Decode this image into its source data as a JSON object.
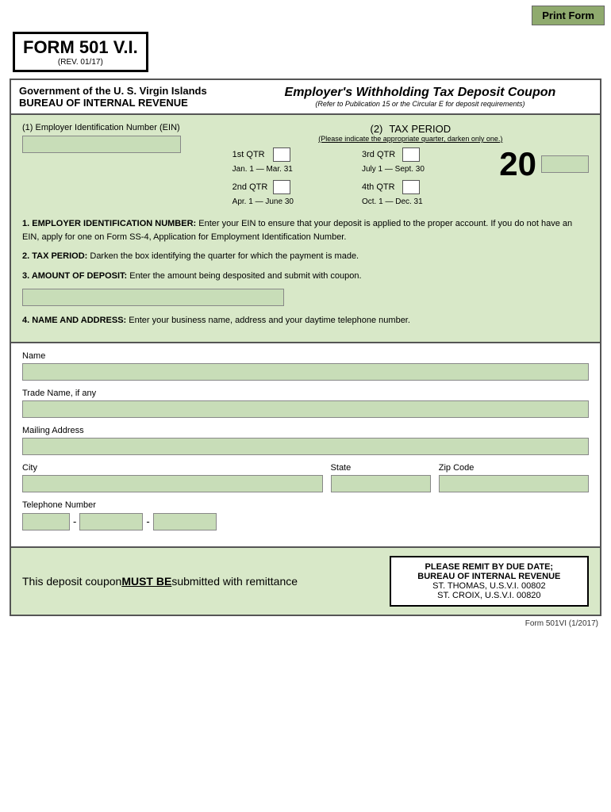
{
  "print_button": "Print Form",
  "form_title": "FORM 501 V.I.",
  "form_rev": "(REV. 01/17)",
  "header": {
    "agency_line1": "Government of the U. S. Virgin Islands",
    "agency_line2": "BUREAU OF INTERNAL REVENUE",
    "coupon_title": "Employer's Withholding Tax Deposit Coupon",
    "coupon_subtitle": "(Refer to Publication 15 or the Circular E for deposit requirements)"
  },
  "section1": {
    "label": "(1) Employer Identification Number (EIN)"
  },
  "section2": {
    "label": "(2)",
    "tax_period": "TAX PERIOD",
    "sublabel": "(Please indicate the appropriate quarter, darken only one.)",
    "q1_label": "1st QTR",
    "q1_date": "Jan. 1 — Mar. 31",
    "q2_label": "2nd QTR",
    "q2_date": "Apr. 1 — June 30",
    "q3_label": "3rd QTR",
    "q3_date": "July 1 — Sept. 30",
    "q4_label": "4th QTR",
    "q4_date": "Oct. 1 — Dec. 31",
    "year_prefix": "20"
  },
  "instructions": {
    "item1_label": "1. EMPLOYER IDENTIFICATION NUMBER:",
    "item1_text": " Enter your EIN to ensure that your deposit is applied to the proper account.  If you do not have an EIN, apply for one on Form SS-4, Application for Employment Identification Number.",
    "item2_label": "2. TAX PERIOD:",
    "item2_text": " Darken the box identifying the quarter for which the payment is made.",
    "item3_label": "3. AMOUNT OF DEPOSIT:",
    "item3_text": " Enter the amount being desposited and submit with coupon.",
    "item4_label": "4. NAME AND ADDRESS:",
    "item4_text": " Enter your business name, address and your daytime telephone number."
  },
  "fields": {
    "name_label": "Name",
    "trade_name_label": "Trade Name, if any",
    "mailing_address_label": "Mailing Address",
    "city_label": "City",
    "state_label": "State",
    "zip_label": "Zip Code",
    "telephone_label": "Telephone Number",
    "phone_separator1": "-",
    "phone_separator2": "-"
  },
  "footer": {
    "left_text_part1": "This deposit coupon ",
    "left_must_be": "MUST BE",
    "left_text_part2": " submitted with remittance",
    "right_title": "PLEASE REMIT BY DUE DATE;",
    "right_title2": "BUREAU OF INTERNAL REVENUE",
    "right_address1": "ST. THOMAS, U.S.V.I. 00802",
    "right_address2": "ST. CROIX, U.S.V.I. 00820"
  },
  "form_footer_note": "Form  501VI (1/2017)"
}
